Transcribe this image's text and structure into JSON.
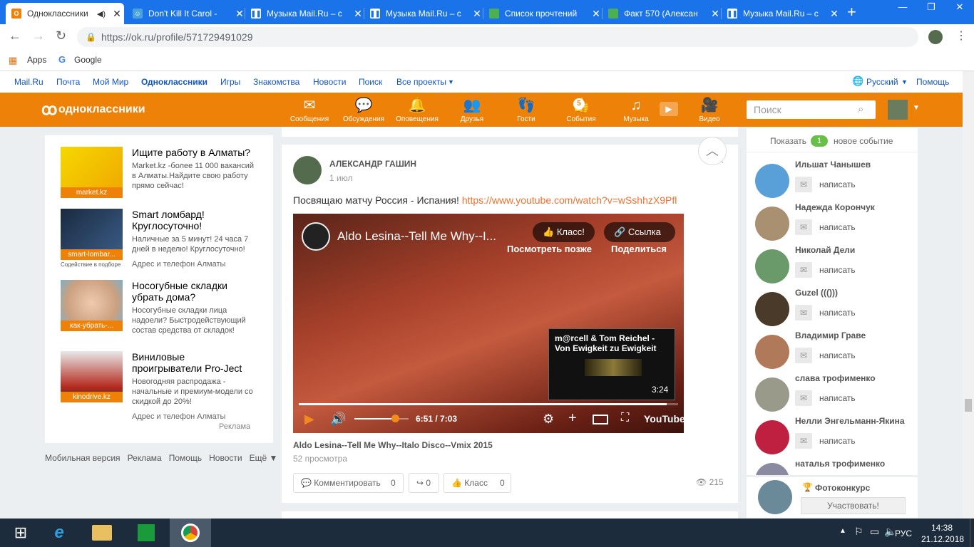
{
  "browser": {
    "tabs": [
      {
        "title": "Одноклассники",
        "active": true
      },
      {
        "title": "Don't Kill It Carol - ",
        "active": false
      },
      {
        "title": "Музыка Mail.Ru – с",
        "active": false
      },
      {
        "title": "Музыка Mail.Ru – с",
        "active": false
      },
      {
        "title": "Список прочтений",
        "active": false
      },
      {
        "title": "Факт 570 (Алексан",
        "active": false
      },
      {
        "title": "Музыка Mail.Ru – с",
        "active": false
      }
    ],
    "url": "https://ok.ru/profile/571729491029",
    "bookmarks": {
      "apps": "Apps",
      "google": "Google"
    }
  },
  "mailbar": {
    "links": [
      "Mail.Ru",
      "Почта",
      "Мой Мир",
      "Одноклассники",
      "Игры",
      "Знакомства",
      "Новости",
      "Поиск",
      "Все проекты"
    ],
    "language": "Русский",
    "help": "Помощь"
  },
  "ok_header": {
    "logo": "одноклассники",
    "nav": [
      {
        "label": "Сообщения",
        "icon": "envelope-icon"
      },
      {
        "label": "Обсуждения",
        "icon": "chat-icon"
      },
      {
        "label": "Оповещения",
        "icon": "bell-icon"
      },
      {
        "label": "Друзья",
        "icon": "friends-icon"
      },
      {
        "label": "Гости",
        "icon": "footprints-icon"
      },
      {
        "label": "События",
        "icon": "events-icon",
        "badge": "5"
      },
      {
        "label": "Музыка",
        "icon": "music-icon"
      },
      {
        "label": "Видео",
        "icon": "video-icon"
      }
    ],
    "search_placeholder": "Поиск"
  },
  "ads": [
    {
      "caption": "market.kz",
      "title": "Ищите работу в Алматы?",
      "desc": "Market.kz -более 11 000 вакансий в Алматы.Найдите свою работу прямо сейчас!",
      "meta": "",
      "extra": ""
    },
    {
      "caption": "smart-lombar...",
      "title": "Smart ломбард! Круглосуточно!",
      "desc": "Наличные за 5 минут! 24 часа 7 дней в неделю! Круглосуточно!",
      "meta": "Адрес и телефон   Алматы",
      "extra": "Содействие в подборе"
    },
    {
      "caption": "как-убрать-...",
      "title": "Носогубные складки убрать дома?",
      "desc": "Носогубные складки лица надоели? Быстродействующий состав средства от складок!",
      "meta": "",
      "extra": ""
    },
    {
      "caption": "kinodrive.kz",
      "title": "Виниловые проигрыватели Pro-Ject",
      "desc": "Новогодняя распродажа - начальные и премиум-модели со скидкой до 20%!",
      "meta": "Адрес и телефон   Алматы",
      "extra": ""
    }
  ],
  "ads_label": "Реклама",
  "footer": [
    "Мобильная версия",
    "Реклама",
    "Помощь",
    "Новости",
    "Ещё ▼"
  ],
  "post": {
    "author": "АЛЕКСАНДР ГАШИН",
    "date": "1 июл",
    "text": "Посвящаю матчу Россия - Испания!",
    "link": "https://www.youtube.com/watch?v=wSshhzX9Pfl",
    "video": {
      "title": "Aldo Lesina--Tell Me Why--I...",
      "class_label": "Класс!",
      "link_label": "Ссылка",
      "watch_later": "Посмотреть позже",
      "share": "Поделиться",
      "suggest_title": "m@rcell & Tom Reichel - Von Ewigkeit zu Ewigkeit",
      "suggest_duration": "3:24",
      "time": "6:51 / 7:03",
      "progress": 0.97,
      "volume": 0.75,
      "youtube": "YouTube"
    },
    "video_title": "Aldo Lesina--Tell Me Why--Italo Disco--Vmix 2015",
    "views_text": "52 просмотра",
    "comment_label": "Комментировать",
    "comment_count": "0",
    "share_count": "0",
    "class_label": "Класс",
    "class_count": "0",
    "view_count": "215"
  },
  "right": {
    "show_label": "Показать",
    "event_count": "1",
    "event_label": "новое событие",
    "write_label": "написать",
    "friends": [
      "Ильшат Чанышев",
      "Надежда Корончук",
      "Николай Дели",
      "Guzel ((()))",
      "Владимир Граве",
      "слава трофименко",
      "Нелли Энгельманн-Якина",
      "наталья трофименко"
    ],
    "photo_contest": "Фотоконкурс",
    "participate": "Участвовать!"
  },
  "taskbar": {
    "lang": "РУС",
    "time": "14:38",
    "date": "21.12.2018"
  },
  "colors": {
    "ok_orange": "#ee8208",
    "chrome_blue": "#1a73e8",
    "taskbar": "#1c2c3c",
    "link_blue": "#1155cc"
  }
}
